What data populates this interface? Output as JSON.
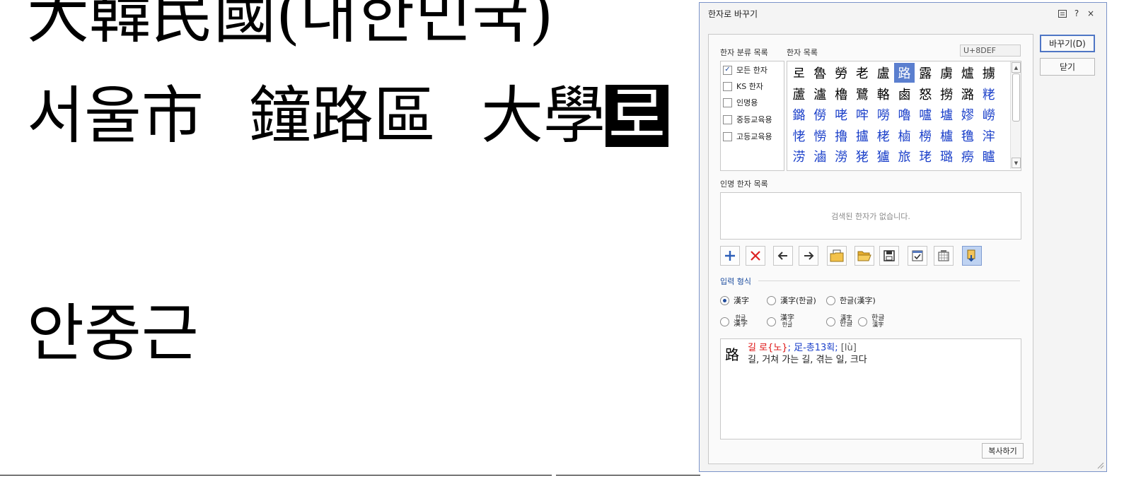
{
  "document": {
    "line1": "大韓民國(대한민국)",
    "line2": {
      "a": "서울市",
      "b": "鐘路區",
      "c": "大學",
      "selected": "로"
    },
    "line3": "안중근"
  },
  "dialog": {
    "title": "한자로 바꾸기",
    "title_buttons": {
      "menu_icon": "menu-icon",
      "help": "?",
      "close": "×"
    },
    "category_label": "한자 분류 목록",
    "hanja_label": "한자 목록",
    "code": "U+8DEF",
    "categories": [
      {
        "label": "모든 한자",
        "checked": true
      },
      {
        "label": "KS 한자",
        "checked": false
      },
      {
        "label": "인명용",
        "checked": false
      },
      {
        "label": "중등교육용",
        "checked": false
      },
      {
        "label": "고등교육용",
        "checked": false
      }
    ],
    "hanja_rows": [
      [
        "로",
        "魯",
        "勞",
        "老",
        "盧",
        "路",
        "露",
        "虜",
        "爐",
        "擄"
      ],
      [
        "蘆",
        "瀘",
        "櫓",
        "鷺",
        "輅",
        "鹵",
        "怒",
        "撈",
        "潞",
        "粩"
      ],
      [
        "鏴",
        "僗",
        "咾",
        "哰",
        "嘮",
        "嚕",
        "嚧",
        "壚",
        "嫪",
        "嶗"
      ],
      [
        "恅",
        "憦",
        "擼",
        "攎",
        "栳",
        "樐",
        "橯",
        "櫨",
        "氇",
        "浶"
      ],
      [
        "涝",
        "滷",
        "澇",
        "狫",
        "獹",
        "旅",
        "珯",
        "璐",
        "癆",
        "矑"
      ]
    ],
    "selected_hanja": "路",
    "name_hanja_label": "인명 한자 목록",
    "name_hanja_empty": "검색된 한자가 없습니다.",
    "toolbar_icons": [
      "add-icon",
      "delete-icon",
      "arrow-left-icon",
      "arrow-right-icon",
      "folder-text-icon",
      "folder-open-icon",
      "save-icon",
      "checklist-icon",
      "calendar-grid-icon",
      "bookmark-down-icon"
    ],
    "input_format_label": "입력 형식",
    "radios_row1": [
      {
        "label": "漢字",
        "checked": true
      },
      {
        "label": "漢字(한글)",
        "checked": false
      },
      {
        "label": "한글(漢字)",
        "checked": false
      }
    ],
    "radios_row2": [
      {
        "top": "한글",
        "bottom": "漢字"
      },
      {
        "top": "漢字",
        "bottom": "한글"
      },
      {
        "top": "漢字",
        "bottom": "한글"
      },
      {
        "top": "한글",
        "bottom": "漢字"
      }
    ],
    "detail": {
      "char": "路",
      "reading": "길 로{노}",
      "sep1": ";",
      "radical": "足-총13획",
      "sep2": ";",
      "pinyin": "[lù]",
      "meaning": "길, 거쳐 가는 길, 겪는 일, 크다"
    },
    "copy_button": "복사하기",
    "convert_button": "바꾸기(D)",
    "close_button": "닫기"
  }
}
